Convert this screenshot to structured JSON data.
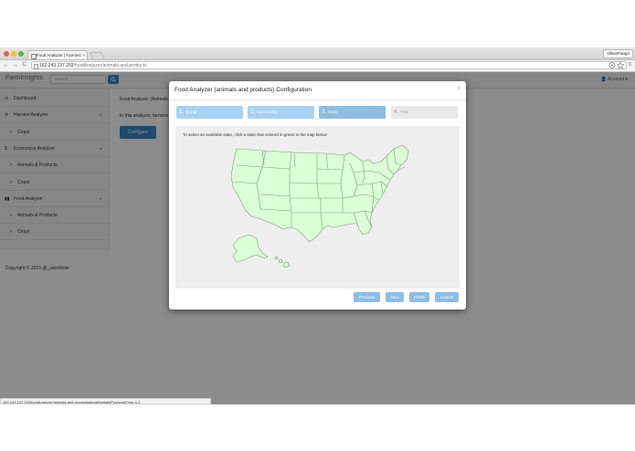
{
  "browser": {
    "tab_title": "Food Analyzer | Farmins",
    "tab_close": "×",
    "profile": "OliverFango",
    "url_host": "162.243.137.203",
    "url_path": "/foodAnalyzer/animals-and-products",
    "back": "←",
    "forward": "→",
    "reload": "C",
    "menu": "≡"
  },
  "app": {
    "brand": "FarmInsights",
    "search_placeholder": "Search",
    "account": "Account ▾",
    "sidebar": [
      {
        "icon": "⊙",
        "label": "Dashboard",
        "sub": false,
        "chevron": ""
      },
      {
        "icon": "⊘",
        "label": "Harvest Analyzer",
        "sub": false,
        "chevron": "▾"
      },
      {
        "icon": "›",
        "label": "Crops",
        "sub": true,
        "chevron": ""
      },
      {
        "icon": "$",
        "label": "Economics Analyzer",
        "sub": false,
        "chevron": "▾"
      },
      {
        "icon": "›",
        "label": "Animals & Products",
        "sub": true,
        "chevron": ""
      },
      {
        "icon": "›",
        "label": "Crops",
        "sub": true,
        "chevron": ""
      },
      {
        "icon": "▮▮",
        "label": "Food Analyzer",
        "sub": false,
        "chevron": "▾"
      },
      {
        "icon": "›",
        "label": "Animals & Products",
        "sub": true,
        "chevron": ""
      },
      {
        "icon": "›",
        "label": "Crops",
        "sub": true,
        "chevron": ""
      }
    ],
    "content_heading": "Food Analyzer (Animals",
    "content_text": "In this analyzer, farmers",
    "configure_button": "Configure",
    "footer": "Copyright © 2015 @_samirkow",
    "status_url": "162.243.137.203/foodAnalyzer/animals-and-products#foodAnimalsProductsForm-h-2"
  },
  "modal": {
    "title": "Food Analyzer (animals and products) Configuration",
    "close": "×",
    "steps": [
      {
        "num": "1.",
        "label": "Group",
        "state": "done"
      },
      {
        "num": "2.",
        "label": "Commodity",
        "state": "done"
      },
      {
        "num": "3.",
        "label": "State",
        "state": "current"
      },
      {
        "num": "4.",
        "label": "Year",
        "state": "disabled"
      }
    ],
    "instruction": "To select an available state, click a state that colored in green in the map below:",
    "buttons": {
      "previous": "Previous",
      "next": "Next",
      "finish": "Finish",
      "cancel": "Cancel"
    }
  },
  "colors": {
    "step_done": "#a9d2f2",
    "step_current": "#8ebde0",
    "step_disabled": "#e8e8e8",
    "map_fill": "#dbffd6",
    "map_stroke": "#7d9b79",
    "primary": "#3a87c8"
  }
}
